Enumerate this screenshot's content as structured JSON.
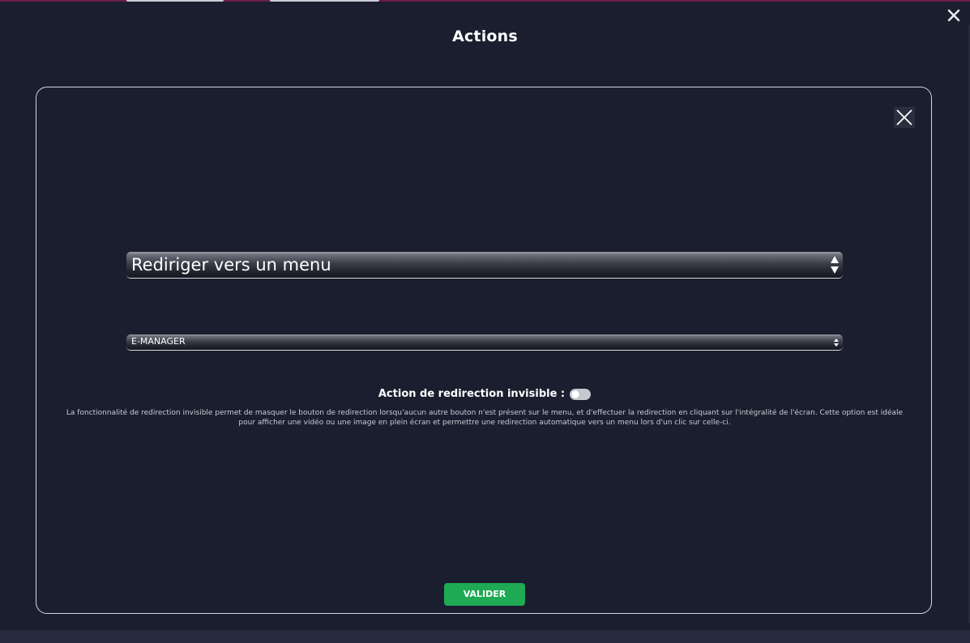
{
  "page": {
    "title": "Actions"
  },
  "modal": {
    "action_type_select": {
      "selected": "Rediriger vers un menu"
    },
    "menu_select": {
      "selected": "E-MANAGER"
    },
    "invisible_redirect": {
      "label": "Action de redirection invisible :",
      "enabled": false
    },
    "help_text": "La fonctionnalité de redirection invisible permet de masquer le bouton de redirection lorsqu'aucun autre bouton n'est présent sur le menu, et d'effectuer la redirection en cliquant sur l'intégralité de l'écran. Cette option est idéale pour afficher une vidéo ou une image en plein écran et permettre une redirection automatique vers un menu lors d'un clic sur celle-ci.",
    "submit_label": "VALIDER"
  },
  "icons": {
    "window_close": "close-icon",
    "modal_close": "close-icon",
    "select_arrows": "select-arrows-icon"
  },
  "colors": {
    "background": "#1a1e2e",
    "accent_green": "#1faa55",
    "panel_border": "#d4d6de",
    "top_strip": "#6b1e46"
  }
}
